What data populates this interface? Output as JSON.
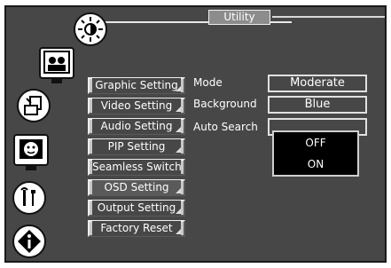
{
  "header": {
    "title": "Utility"
  },
  "sidebar": {
    "icons": [
      {
        "name": "brightness-icon"
      },
      {
        "name": "picture-icon"
      },
      {
        "name": "input-icon"
      },
      {
        "name": "osd-icon"
      },
      {
        "name": "tools-icon"
      },
      {
        "name": "info-icon"
      }
    ]
  },
  "menu": {
    "items": [
      {
        "label": "Graphic Setting"
      },
      {
        "label": "Video Setting"
      },
      {
        "label": "Audio Setting"
      },
      {
        "label": "PIP Setting"
      },
      {
        "label": "Seamless Switch"
      },
      {
        "label": "OSD Setting"
      },
      {
        "label": "Output Setting"
      },
      {
        "label": "Factory Reset"
      }
    ]
  },
  "options": {
    "mode": {
      "label": "Mode",
      "value": "Moderate"
    },
    "background": {
      "label": "Background",
      "value": "Blue"
    },
    "auto_search": {
      "label": "Auto Search"
    }
  },
  "dropdown": {
    "options": [
      "OFF",
      "ON"
    ]
  }
}
